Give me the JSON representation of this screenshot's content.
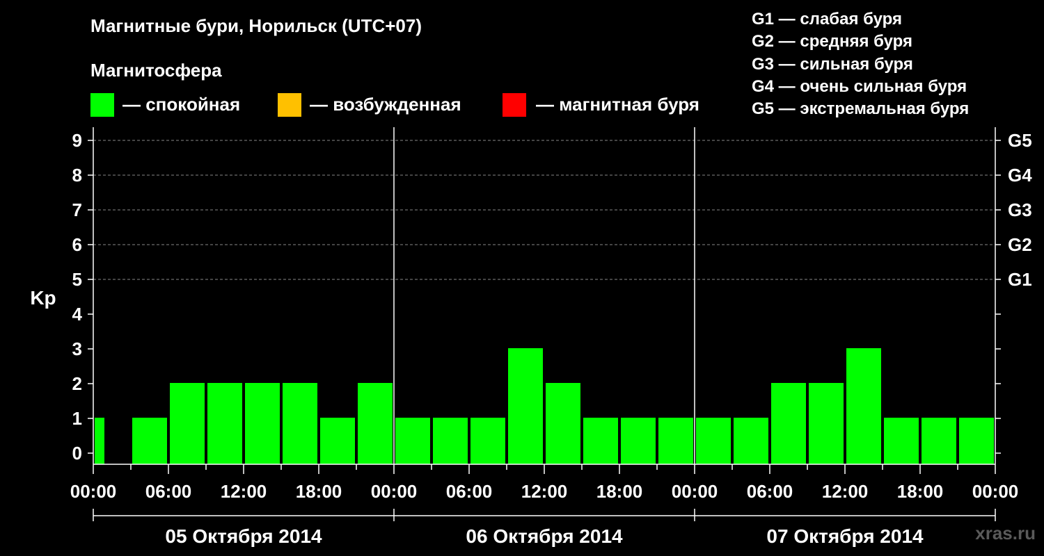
{
  "title": "Магнитные бури, Норильск (UTC+07)",
  "legend_title": "Магнитосфера",
  "legend": [
    {
      "label": "— спокойная",
      "color": "#00ff00"
    },
    {
      "label": "— возбужденная",
      "color": "#ffc000"
    },
    {
      "label": "— магнитная буря",
      "color": "#ff0000"
    }
  ],
  "g_scale": [
    "G1 — слабая буря",
    "G2 — средняя буря",
    "G3 — сильная буря",
    "G4 — очень сильная буря",
    "G5 — экстремальная буря"
  ],
  "watermark": "xras.ru",
  "chart_data": {
    "type": "bar",
    "ylabel": "Kp",
    "ylim": [
      0,
      9
    ],
    "yticks": [
      "0",
      "1",
      "2",
      "3",
      "4",
      "5",
      "6",
      "7",
      "8",
      "9"
    ],
    "right_ticks": [
      {
        "kp": 5,
        "label": "G1"
      },
      {
        "kp": 6,
        "label": "G2"
      },
      {
        "kp": 7,
        "label": "G3"
      },
      {
        "kp": 8,
        "label": "G4"
      },
      {
        "kp": 9,
        "label": "G5"
      }
    ],
    "grid": "dashed horizontal at Kp 5-9",
    "xtick_labels": [
      "00:00",
      "06:00",
      "12:00",
      "18:00",
      "00:00",
      "06:00",
      "12:00",
      "18:00",
      "00:00",
      "06:00",
      "12:00",
      "18:00",
      "00:00"
    ],
    "days": [
      "05 Октября 2014",
      "06 Октября 2014",
      "07 Октября 2014"
    ],
    "bar_hours_start": [
      0,
      3,
      6,
      9,
      12,
      15,
      18,
      21,
      24,
      27,
      30,
      33,
      36,
      39,
      42,
      45,
      48,
      51,
      54,
      57,
      60,
      63,
      66,
      69
    ],
    "bar_hours_end": [
      1,
      6,
      9,
      12,
      15,
      18,
      21,
      24,
      27,
      30,
      33,
      36,
      39,
      42,
      45,
      48,
      51,
      54,
      57,
      60,
      63,
      66,
      69,
      72
    ],
    "values": [
      1,
      1,
      2,
      2,
      2,
      2,
      1,
      2,
      1,
      1,
      1,
      3,
      2,
      1,
      1,
      1,
      1,
      1,
      2,
      2,
      3,
      1,
      1,
      1
    ],
    "colors": [
      "#00ff00"
    ]
  }
}
